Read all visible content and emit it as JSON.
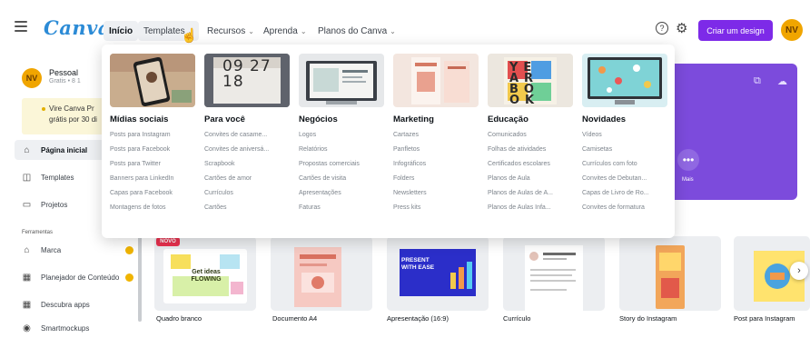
{
  "header": {
    "logo": "Canva",
    "nav": [
      {
        "label": "Início",
        "chevron": false
      },
      {
        "label": "Templates",
        "chevron": true
      },
      {
        "label": "Recursos",
        "chevron": true
      },
      {
        "label": "Aprenda",
        "chevron": true
      },
      {
        "label": "Planos do Canva",
        "chevron": true
      }
    ],
    "help_glyph": "?",
    "cta_label": "Criar um design",
    "avatar_initials": "NV"
  },
  "sidebar": {
    "avatar_initials": "NV",
    "account_name": "Pessoal",
    "account_sub": "Gratis • 8 1",
    "promo_line1": "Vire Canva Pr",
    "promo_line2": "grátis por 30 di",
    "items": [
      {
        "label": "Página inicial",
        "icon": "home-icon",
        "glyph": "⌂"
      },
      {
        "label": "Templates",
        "icon": "templates-icon",
        "glyph": "◫"
      },
      {
        "label": "Projetos",
        "icon": "folder-icon",
        "glyph": "▭"
      }
    ],
    "section_label": "Ferramentas",
    "tools": [
      {
        "label": "Marca",
        "icon": "brand-icon",
        "glyph": "⌂",
        "badge": true
      },
      {
        "label": "Planejador de Conteúdo",
        "icon": "calendar-icon",
        "glyph": "▦",
        "badge": true
      },
      {
        "label": "Descubra apps",
        "icon": "apps-icon",
        "glyph": "▦",
        "badge": false
      },
      {
        "label": "Smartmockups",
        "icon": "mockups-icon",
        "glyph": "◉",
        "badge": false
      }
    ]
  },
  "dropdown": {
    "columns": [
      {
        "title": "Mídias sociais",
        "links": [
          "Posts para Instagram",
          "Posts para Facebook",
          "Posts para Twitter",
          "Banners para LinkedIn",
          "Capas para Facebook",
          "Montagens de fotos"
        ]
      },
      {
        "title": "Para você",
        "links": [
          "Convites de casame...",
          "Convites de aniversá...",
          "Scrapbook",
          "Cartões de amor",
          "Currículos",
          "Cartões"
        ]
      },
      {
        "title": "Negócios",
        "links": [
          "Logos",
          "Relatórios",
          "Propostas comerciais",
          "Cartões de visita",
          "Apresentações",
          "Faturas"
        ]
      },
      {
        "title": "Marketing",
        "links": [
          "Cartazes",
          "Panfletos",
          "Infográficos",
          "Folders",
          "Newsletters",
          "Press kits"
        ]
      },
      {
        "title": "Educação",
        "links": [
          "Comunicados",
          "Folhas de atividades",
          "Certificados escolares",
          "Planos de Aula",
          "Planos de Aulas de A...",
          "Planos de Aulas Infa..."
        ]
      },
      {
        "title": "Novidades",
        "links": [
          "Vídeos",
          "Camisetas",
          "Currículos com foto",
          "Convites de Debutan...",
          "Capas de Livro de Ro...",
          "Convites de formatura"
        ]
      }
    ],
    "thumb_texts": {
      "calendar": "09 27 18",
      "education": "YE AR BO OK"
    }
  },
  "banner": {
    "mais_label": "Mais"
  },
  "cards": {
    "novo_badge": "NOVO",
    "whiteboard_text": "Get ideas FLOWING",
    "presentation_text": "PRESENT WITH EASE",
    "items": [
      "Quadro branco",
      "Documento A4",
      "Apresentação (16:9)",
      "Currículo",
      "Story do Instagram",
      "Post para Instagram"
    ]
  },
  "colors": {
    "brand_purple": "#7d2ae8",
    "logo_blue": "#2c8bd6",
    "avatar": "#f0a500",
    "banner": "#7c4bdc",
    "badge_red": "#e9314f"
  }
}
